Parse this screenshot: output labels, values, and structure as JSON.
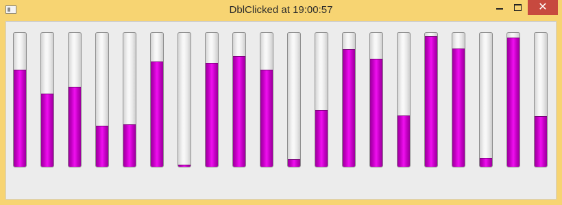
{
  "window": {
    "title": "DblClicked at 19:00:57",
    "controls": {
      "minimize": "minimize-icon",
      "maximize": "maximize-icon",
      "close": "close-icon"
    }
  },
  "colors": {
    "title_bar": "#f7d472",
    "client_bg": "#ececec",
    "bar_fill": "#e010e0",
    "track": "#ebebeb",
    "close_button": "#c7493f"
  },
  "progress_bars": [
    {
      "value": 0.72
    },
    {
      "value": 0.54
    },
    {
      "value": 0.59
    },
    {
      "value": 0.3
    },
    {
      "value": 0.31
    },
    {
      "value": 0.78
    },
    {
      "value": 0.01
    },
    {
      "value": 0.77
    },
    {
      "value": 0.82
    },
    {
      "value": 0.72
    },
    {
      "value": 0.05
    },
    {
      "value": 0.42
    },
    {
      "value": 0.87
    },
    {
      "value": 0.8
    },
    {
      "value": 0.38
    },
    {
      "value": 0.97
    },
    {
      "value": 0.88
    },
    {
      "value": 0.06
    },
    {
      "value": 0.96
    },
    {
      "value": 0.37
    }
  ]
}
